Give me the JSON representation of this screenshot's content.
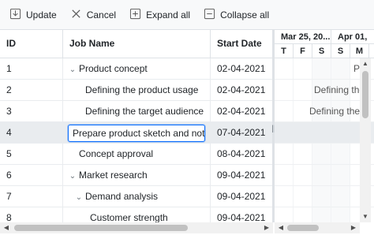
{
  "toolbar": {
    "update_label": "Update",
    "cancel_label": "Cancel",
    "expand_label": "Expand all",
    "collapse_label": "Collapse all"
  },
  "grid": {
    "columns": {
      "id": "ID",
      "name": "Job Name",
      "start": "Start Date"
    },
    "rows": [
      {
        "id": "1",
        "name": "Product concept",
        "start": "02-04-2021"
      },
      {
        "id": "2",
        "name": "Defining the product usage",
        "start": "02-04-2021"
      },
      {
        "id": "3",
        "name": "Defining the target audience",
        "start": "02-04-2021"
      },
      {
        "id": "4",
        "name": "Prepare product sketch and notes",
        "start": "07-04-2021"
      },
      {
        "id": "5",
        "name": "Concept approval",
        "start": "08-04-2021"
      },
      {
        "id": "6",
        "name": "Market research",
        "start": "09-04-2021"
      },
      {
        "id": "7",
        "name": "Demand analysis",
        "start": "09-04-2021"
      },
      {
        "id": "8",
        "name": "Customer strength",
        "start": "09-04-2021"
      }
    ],
    "edit_value": "Prepare product sketch and notes"
  },
  "timeline": {
    "weeks": [
      "Mar 25, 20...",
      "Apr 01,"
    ],
    "days": [
      "T",
      "F",
      "S",
      "S",
      "M"
    ],
    "labels": {
      "row1": "P",
      "row2": "Defining the",
      "row3": "Defining the t"
    }
  },
  "icons": {
    "update": "save-download-icon",
    "cancel": "x-icon",
    "expand": "plus-square-icon",
    "collapse": "minus-square-icon"
  },
  "colors": {
    "edit_border": "#0d6efd",
    "selected_row": "#e9ecef",
    "border": "#dee2e6"
  }
}
